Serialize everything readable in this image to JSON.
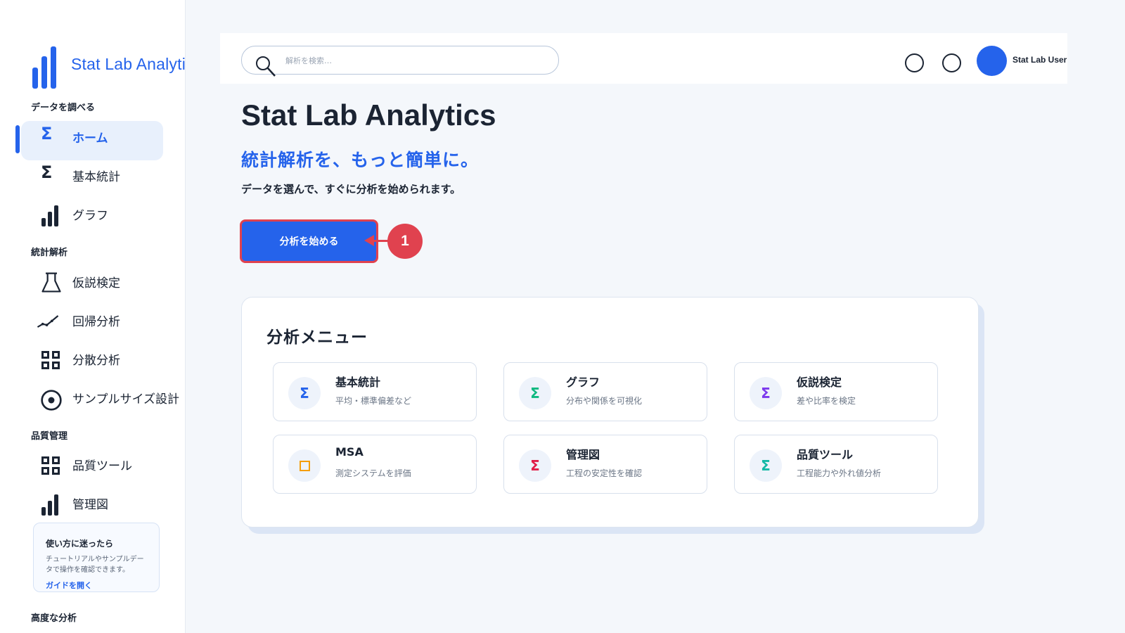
{
  "app": {
    "brand_title": "Stat Lab Analytics",
    "accent_color": "#2563eb",
    "callout_color": "#e0424f"
  },
  "sidebar": {
    "sections": [
      {
        "label": "データを調べる"
      },
      {
        "label": "統計解析"
      },
      {
        "label": "品質管理"
      },
      {
        "label": "高度な分析"
      }
    ],
    "items": [
      {
        "label": "ホーム",
        "icon": "sigma-icon",
        "active": true
      },
      {
        "label": "基本統計",
        "icon": "sigma-icon"
      },
      {
        "label": "グラフ",
        "icon": "bar-chart-icon"
      },
      {
        "label": "仮説検定",
        "icon": "flask-icon"
      },
      {
        "label": "回帰分析",
        "icon": "trend-line-icon"
      },
      {
        "label": "分散分析",
        "icon": "grid-icon"
      },
      {
        "label": "サンプルサイズ設計",
        "icon": "target-icon"
      },
      {
        "label": "品質ツール",
        "icon": "grid-icon"
      },
      {
        "label": "管理図",
        "icon": "bar-chart-icon"
      }
    ],
    "help": {
      "title": "使い方に迷ったら",
      "body": "チュートリアルやサンプルデータで操作を確認できます。",
      "link": "ガイドを開く"
    }
  },
  "topbar": {
    "search_placeholder": "解析を検索…",
    "user_name": "Stat Lab User"
  },
  "hero": {
    "title": "Stat Lab Analytics",
    "subtitle": "統計解析を、もっと簡単に。",
    "description": "データを選んで、すぐに分析を始められます。",
    "start_button": "分析を始める",
    "callout_number": "1"
  },
  "menu": {
    "title": "分析メニュー",
    "tiles": [
      {
        "title": "基本統計",
        "desc": "平均・標準偏差など",
        "icon": "sigma-icon",
        "color": "#2563eb"
      },
      {
        "title": "グラフ",
        "desc": "分布や関係を可視化",
        "icon": "sigma-icon",
        "color": "#10b981"
      },
      {
        "title": "仮説検定",
        "desc": "差や比率を検定",
        "icon": "sigma-icon",
        "color": "#7c3aed"
      },
      {
        "title": "MSA",
        "desc": "測定システムを評価",
        "icon": "square-icon",
        "color": "#f59e0b"
      },
      {
        "title": "管理図",
        "desc": "工程の安定性を確認",
        "icon": "sigma-icon",
        "color": "#e11d48"
      },
      {
        "title": "品質ツール",
        "desc": "工程能力や外れ値分析",
        "icon": "sigma-icon",
        "color": "#14b8a6"
      }
    ]
  }
}
